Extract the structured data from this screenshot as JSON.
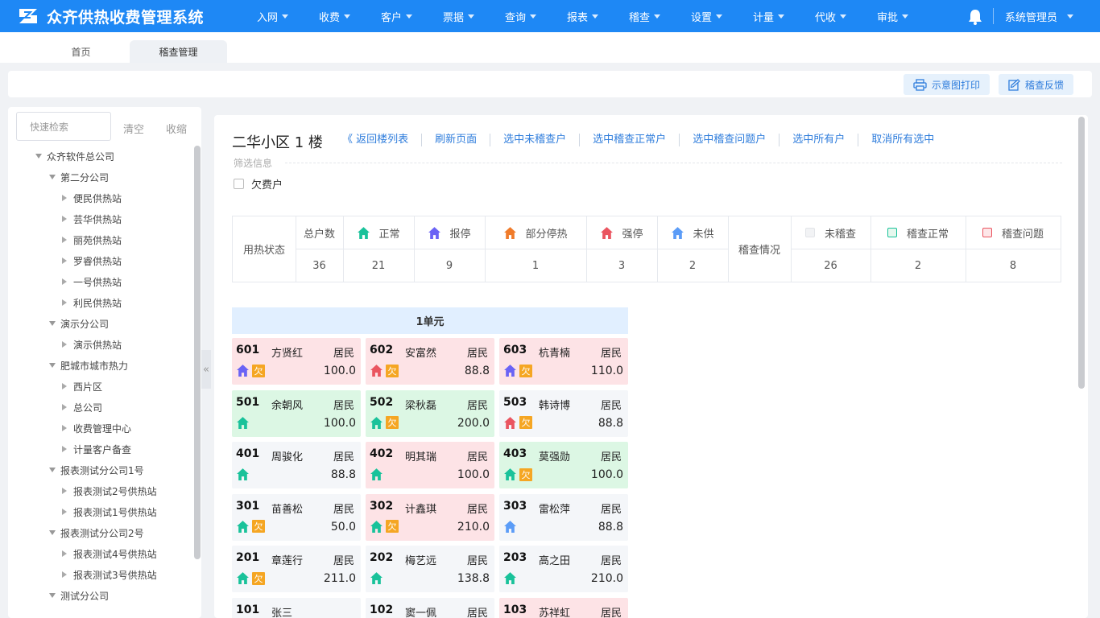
{
  "app": {
    "title": "众齐供热收费管理系统"
  },
  "nav": [
    {
      "label": "入网"
    },
    {
      "label": "收费"
    },
    {
      "label": "客户"
    },
    {
      "label": "票据"
    },
    {
      "label": "查询"
    },
    {
      "label": "报表"
    },
    {
      "label": "稽查"
    },
    {
      "label": "设置"
    },
    {
      "label": "计量"
    },
    {
      "label": "代收"
    },
    {
      "label": "审批"
    }
  ],
  "user": {
    "name": "系统管理员"
  },
  "tabs": [
    {
      "label": "首页"
    },
    {
      "label": "稽查管理"
    }
  ],
  "toolbar": {
    "print_label": "示意图打印",
    "feedback_label": "稽查反馈"
  },
  "sidebar": {
    "search_placeholder": "快速检索",
    "clear_label": "清空",
    "collapse_label": "收缩",
    "tree": [
      {
        "label": "众齐软件总公司",
        "level": 0,
        "expanded": true
      },
      {
        "label": "第二分公司",
        "level": 1,
        "expanded": true
      },
      {
        "label": "便民供热站",
        "level": 2,
        "expanded": false
      },
      {
        "label": "芸华供热站",
        "level": 2,
        "expanded": false
      },
      {
        "label": "丽苑供热站",
        "level": 2,
        "expanded": false
      },
      {
        "label": "罗睿供热站",
        "level": 2,
        "expanded": false
      },
      {
        "label": "一号供热站",
        "level": 2,
        "expanded": false
      },
      {
        "label": "利民供热站",
        "level": 2,
        "expanded": false
      },
      {
        "label": "演示分公司",
        "level": 1,
        "expanded": true
      },
      {
        "label": "演示供热站",
        "level": 2,
        "expanded": false
      },
      {
        "label": "肥城市城市热力",
        "level": 1,
        "expanded": true
      },
      {
        "label": "西片区",
        "level": 2,
        "expanded": false
      },
      {
        "label": "总公司",
        "level": 2,
        "expanded": false
      },
      {
        "label": "收费管理中心",
        "level": 2,
        "expanded": false
      },
      {
        "label": "计量客户备查",
        "level": 2,
        "expanded": false
      },
      {
        "label": "报表测试分公司1号",
        "level": 1,
        "expanded": true
      },
      {
        "label": "报表测试2号供热站",
        "level": 2,
        "expanded": false
      },
      {
        "label": "报表测试1号供热站",
        "level": 2,
        "expanded": false
      },
      {
        "label": "报表测试分公司2号",
        "level": 1,
        "expanded": true
      },
      {
        "label": "报表测试4号供热站",
        "level": 2,
        "expanded": false
      },
      {
        "label": "报表测试3号供热站",
        "level": 2,
        "expanded": false
      },
      {
        "label": "测试分公司",
        "level": 1,
        "expanded": true
      }
    ]
  },
  "building": {
    "title": "二华小区 1 楼",
    "actions": [
      {
        "label": "《 返回楼列表"
      },
      {
        "label": "刷新页面"
      },
      {
        "label": "选中未稽查户"
      },
      {
        "label": "选中稽查正常户"
      },
      {
        "label": "选中稽查问题户"
      },
      {
        "label": "选中所有户"
      },
      {
        "label": "取消所有选中"
      }
    ],
    "filter_title": "筛选信息",
    "arrears_label": "欠费户"
  },
  "summary": {
    "heat_label": "用热状态",
    "total_label": "总户数",
    "total": "36",
    "statuses": [
      {
        "label": "正常",
        "value": "21",
        "color": "#19c29a"
      },
      {
        "label": "报停",
        "value": "9",
        "color": "#6a63f5"
      },
      {
        "label": "部分停热",
        "value": "1",
        "color": "#f07b2a"
      },
      {
        "label": "强停",
        "value": "3",
        "color": "#ea5560"
      },
      {
        "label": "未供",
        "value": "2",
        "color": "#5b9cf7"
      }
    ],
    "inspect_label": "稽查情况",
    "inspections": [
      {
        "label": "未稽查",
        "value": "26",
        "fill": "#f2f3f5",
        "stroke": "#e2e4e8"
      },
      {
        "label": "稽查正常",
        "value": "2",
        "fill": "#e6f8ee",
        "stroke": "#19c29a"
      },
      {
        "label": "稽查问题",
        "value": "8",
        "fill": "#fde6e8",
        "stroke": "#ea5560"
      }
    ]
  },
  "unit": {
    "title": "1单元",
    "rooms": [
      {
        "no": "601",
        "name": "方贤红",
        "type": "居民",
        "amount": "100.0",
        "status": "报停",
        "owe": true,
        "inspect": "问题",
        "owe_label": "欠"
      },
      {
        "no": "602",
        "name": "安富然",
        "type": "居民",
        "amount": "88.8",
        "status": "强停",
        "owe": true,
        "inspect": "问题",
        "owe_label": "欠"
      },
      {
        "no": "603",
        "name": "杭青楠",
        "type": "居民",
        "amount": "110.0",
        "status": "报停",
        "owe": true,
        "inspect": "问题",
        "owe_label": "欠"
      },
      {
        "no": "501",
        "name": "余朝风",
        "type": "居民",
        "amount": "100.0",
        "status": "正常",
        "owe": false,
        "inspect": "正常",
        "owe_label": ""
      },
      {
        "no": "502",
        "name": "梁秋磊",
        "type": "居民",
        "amount": "200.0",
        "status": "正常",
        "owe": true,
        "inspect": "正常",
        "owe_label": "欠"
      },
      {
        "no": "503",
        "name": "韩诗博",
        "type": "居民",
        "amount": "88.8",
        "status": "强停",
        "owe": true,
        "inspect": "未稽查",
        "owe_label": "欠"
      },
      {
        "no": "401",
        "name": "周骏化",
        "type": "居民",
        "amount": "88.8",
        "status": "正常",
        "owe": false,
        "inspect": "未稽查",
        "owe_label": ""
      },
      {
        "no": "402",
        "name": "明其瑞",
        "type": "居民",
        "amount": "100.0",
        "status": "正常",
        "owe": false,
        "inspect": "问题",
        "owe_label": ""
      },
      {
        "no": "403",
        "name": "莫强勋",
        "type": "居民",
        "amount": "100.0",
        "status": "正常",
        "owe": true,
        "inspect": "正常",
        "owe_label": "欠"
      },
      {
        "no": "301",
        "name": "苗善松",
        "type": "居民",
        "amount": "50.0",
        "status": "正常",
        "owe": true,
        "inspect": "未稽查",
        "owe_label": "欠"
      },
      {
        "no": "302",
        "name": "计鑫琪",
        "type": "居民",
        "amount": "210.0",
        "status": "正常",
        "owe": true,
        "inspect": "问题",
        "owe_label": "欠"
      },
      {
        "no": "303",
        "name": "雷松萍",
        "type": "居民",
        "amount": "88.8",
        "status": "未供",
        "owe": false,
        "inspect": "未稽查",
        "owe_label": ""
      },
      {
        "no": "201",
        "name": "章莲行",
        "type": "居民",
        "amount": "211.0",
        "status": "正常",
        "owe": true,
        "inspect": "未稽查",
        "owe_label": "欠"
      },
      {
        "no": "202",
        "name": "梅艺远",
        "type": "居民",
        "amount": "138.8",
        "status": "正常",
        "owe": false,
        "inspect": "未稽查",
        "owe_label": ""
      },
      {
        "no": "203",
        "name": "高之田",
        "type": "居民",
        "amount": "210.0",
        "status": "正常",
        "owe": false,
        "inspect": "未稽查",
        "owe_label": ""
      },
      {
        "no": "101",
        "name": "张三",
        "type": "",
        "amount": "",
        "status": "",
        "owe": false,
        "inspect": "未稽查",
        "owe_label": ""
      },
      {
        "no": "102",
        "name": "窦一佩",
        "type": "居民",
        "amount": "",
        "status": "",
        "owe": false,
        "inspect": "未稽查",
        "owe_label": ""
      },
      {
        "no": "103",
        "name": "苏祥虹",
        "type": "居民",
        "amount": "",
        "status": "",
        "owe": false,
        "inspect": "问题",
        "owe_label": ""
      }
    ]
  },
  "status_colors": {
    "正常": "#19c29a",
    "报停": "#6a63f5",
    "部分停热": "#f07b2a",
    "强停": "#ea5560",
    "未供": "#5b9cf7"
  },
  "icons": [
    "logo-icon",
    "bell-icon",
    "printer-icon",
    "feedback-icon",
    "house-icon",
    "chevron-down-icon",
    "collapse-left-icon"
  ]
}
